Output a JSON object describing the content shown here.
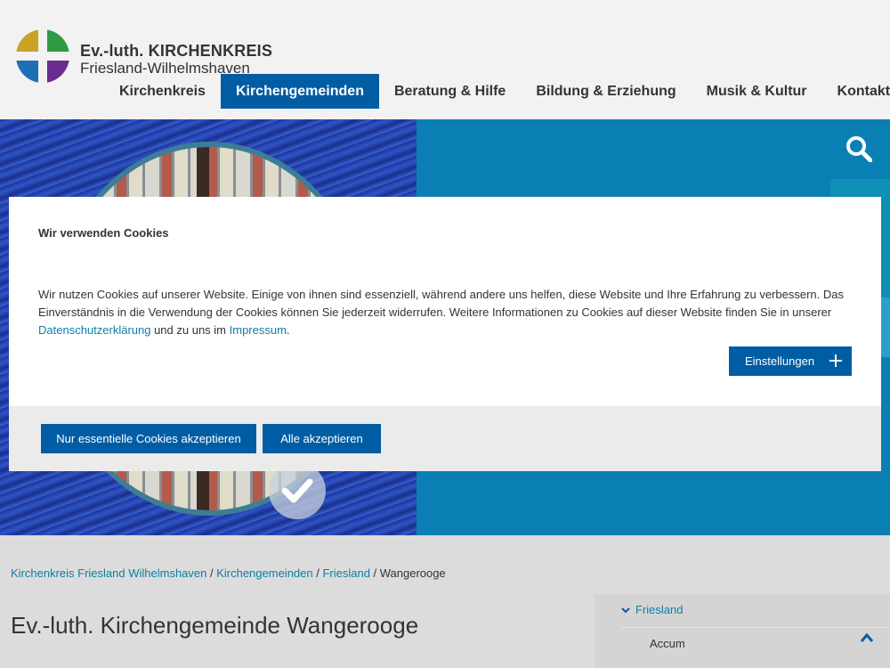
{
  "header": {
    "logo_line1": "Ev.-luth. KIRCHENKREIS",
    "logo_line2": "Friesland-Wilhelmshaven",
    "nav": [
      {
        "label": "Kirchenkreis",
        "active": false
      },
      {
        "label": "Kirchengemeinden",
        "active": true
      },
      {
        "label": "Beratung & Hilfe",
        "active": false
      },
      {
        "label": "Bildung & Erziehung",
        "active": false
      },
      {
        "label": "Musik & Kultur",
        "active": false
      },
      {
        "label": "Kontakt",
        "active": false
      }
    ]
  },
  "hero": {
    "search_icon": "search-icon",
    "check_icon": "check-icon"
  },
  "cookie": {
    "title": "Wir verwenden Cookies",
    "text_part1": "Wir nutzen Cookies auf unserer Website. Einige von ihnen sind essenziell, während andere uns helfen, diese Website und Ihre Erfahrung zu verbessern. Das Einverständnis in die Verwendung der Cookies können Sie jederzeit widerrufen. Weitere Informationen zu Cookies auf dieser Website finden Sie in unserer ",
    "privacy_link": "Datenschutzerklärung",
    "text_part2": " und zu uns im ",
    "imprint_link": "Impressum",
    "text_part3": ".",
    "settings_label": "Einstellungen",
    "essential_label": "Nur essentielle Cookies akzeptieren",
    "all_label": "Alle akzeptieren"
  },
  "breadcrumb": {
    "items": [
      "Kirchenkreis Friesland Wilhelmshaven",
      "Kirchengemeinden",
      "Friesland"
    ],
    "separator": " / ",
    "current": "Wangerooge"
  },
  "page": {
    "title": "Ev.-luth. Kirchengemeinde Wangerooge"
  },
  "subnav": {
    "heading": "Friesland",
    "items": [
      "Accum"
    ]
  },
  "colors": {
    "primary": "#005da3",
    "link": "#0c7fa6",
    "hero_bg": "#0a7fb3"
  }
}
